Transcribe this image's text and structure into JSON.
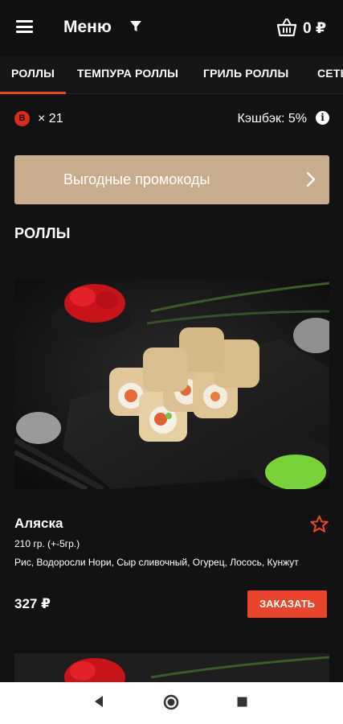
{
  "appbar": {
    "title": "Меню",
    "cart_amount": "0 ₽"
  },
  "tabs": [
    {
      "label": "РОЛЛЫ",
      "active": true
    },
    {
      "label": "ТЕМПУРА РОЛЛЫ",
      "active": false
    },
    {
      "label": "ГРИЛЬ РОЛЛЫ",
      "active": false
    },
    {
      "label": "СЕТЫ",
      "active": false
    }
  ],
  "bonus": {
    "icon_letter": "B",
    "count": "× 21",
    "cashback": "Кэшбэк: 5%",
    "info_glyph": "i"
  },
  "promo": {
    "label": "Выгодные промокоды"
  },
  "section": {
    "title": "РОЛЛЫ"
  },
  "product": {
    "name": "Аляска",
    "weight": "210 гр. (+-5гр.)",
    "ingredients": "Рис, Водоросли Нори, Сыр сливочный, Огурец, Лосось, Кунжут",
    "price": "327 ₽",
    "order_label": "ЗАКАЗАТЬ"
  },
  "colors": {
    "background": "#121212",
    "accent": "#e8452b",
    "promo": "#c8ac8e",
    "navbar": "#ffffff"
  },
  "icons": [
    "menu-icon",
    "filter-icon",
    "basket-icon",
    "bonus-coin-icon",
    "info-icon",
    "chevron-right-icon",
    "star-outline-icon",
    "back-icon",
    "home-icon",
    "recents-icon"
  ]
}
